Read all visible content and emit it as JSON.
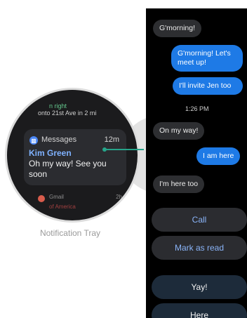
{
  "notification_tray": {
    "previous_line1": "n right",
    "previous_line2": "onto 21st Ave in 2 mi",
    "card": {
      "app_name": "Messages",
      "time": "12m",
      "sender": "Kim Green",
      "message": "Oh my way! See you soon"
    },
    "next_item": {
      "app_name": "Gmail",
      "time": "2h",
      "peek": "of America"
    },
    "caption": "Notification Tray"
  },
  "conversation": {
    "messages": [
      {
        "text": "G'morning!",
        "direction": "incoming"
      },
      {
        "text": "G'morning! Let's meet up!",
        "direction": "outgoing"
      },
      {
        "text": "I'll invite Jen too",
        "direction": "outgoing"
      },
      {
        "text": "On my way!",
        "direction": "incoming"
      },
      {
        "text": "I am here",
        "direction": "outgoing"
      },
      {
        "text": "I'm here too",
        "direction": "incoming"
      }
    ],
    "timestamp": "1:26 PM",
    "actions": [
      "Call",
      "Mark as read"
    ],
    "quick_replies": [
      "Yay!",
      "Here"
    ]
  },
  "colors": {
    "accent_blue": "#1e7ae6",
    "link_blue": "#8ab4f8",
    "connector_teal": "#26a48a",
    "sender_blue": "#7fb2ff"
  },
  "icons": [
    "messages-icon",
    "gmail-icon"
  ]
}
